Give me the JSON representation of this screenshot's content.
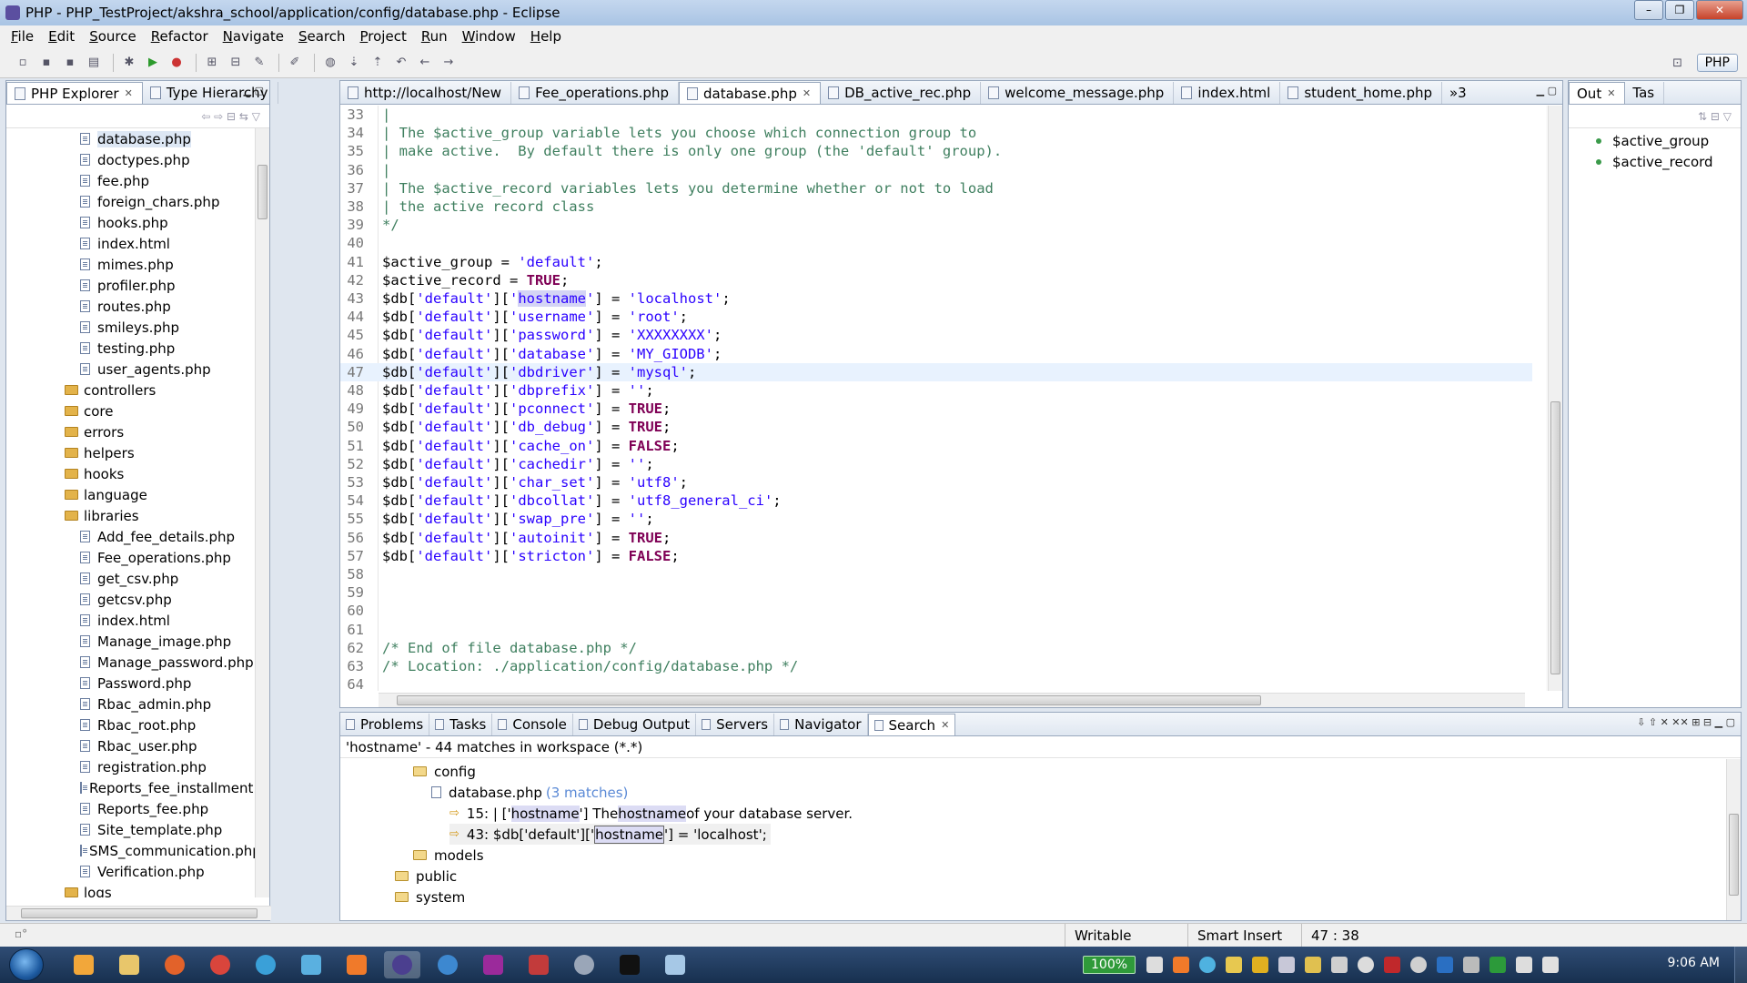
{
  "window": {
    "title": "PHP - PHP_TestProject/akshra_school/application/config/database.php - Eclipse",
    "min": "–",
    "max": "❐",
    "close": "✕"
  },
  "menu": [
    "File",
    "Edit",
    "Source",
    "Refactor",
    "Navigate",
    "Search",
    "Project",
    "Run",
    "Window",
    "Help"
  ],
  "perspective": {
    "label": "PHP"
  },
  "explorer": {
    "tabs": [
      {
        "label": "PHP Explorer",
        "close": "✕"
      },
      {
        "label": "Type Hierarchy"
      }
    ],
    "items": [
      {
        "label": "database.php",
        "kind": "file",
        "indent": 1,
        "selected": true
      },
      {
        "label": "doctypes.php",
        "kind": "file",
        "indent": 1
      },
      {
        "label": "fee.php",
        "kind": "file",
        "indent": 1
      },
      {
        "label": "foreign_chars.php",
        "kind": "file",
        "indent": 1
      },
      {
        "label": "hooks.php",
        "kind": "file",
        "indent": 1
      },
      {
        "label": "index.html",
        "kind": "file",
        "indent": 1
      },
      {
        "label": "mimes.php",
        "kind": "file",
        "indent": 1
      },
      {
        "label": "profiler.php",
        "kind": "file",
        "indent": 1
      },
      {
        "label": "routes.php",
        "kind": "file",
        "indent": 1
      },
      {
        "label": "smileys.php",
        "kind": "file",
        "indent": 1
      },
      {
        "label": "testing.php",
        "kind": "file",
        "indent": 1
      },
      {
        "label": "user_agents.php",
        "kind": "file",
        "indent": 1
      },
      {
        "label": "controllers",
        "kind": "folder",
        "indent": 0
      },
      {
        "label": "core",
        "kind": "folder",
        "indent": 0
      },
      {
        "label": "errors",
        "kind": "folder",
        "indent": 0
      },
      {
        "label": "helpers",
        "kind": "folder",
        "indent": 0
      },
      {
        "label": "hooks",
        "kind": "folder",
        "indent": 0
      },
      {
        "label": "language",
        "kind": "folder",
        "indent": 0
      },
      {
        "label": "libraries",
        "kind": "folder",
        "indent": 0
      },
      {
        "label": "Add_fee_details.php",
        "kind": "file",
        "indent": 1
      },
      {
        "label": "Fee_operations.php",
        "kind": "file",
        "indent": 1
      },
      {
        "label": "get_csv.php",
        "kind": "file",
        "indent": 1
      },
      {
        "label": "getcsv.php",
        "kind": "file",
        "indent": 1
      },
      {
        "label": "index.html",
        "kind": "file",
        "indent": 1
      },
      {
        "label": "Manage_image.php",
        "kind": "file",
        "indent": 1
      },
      {
        "label": "Manage_password.php",
        "kind": "file",
        "indent": 1
      },
      {
        "label": "Password.php",
        "kind": "file",
        "indent": 1
      },
      {
        "label": "Rbac_admin.php",
        "kind": "file",
        "indent": 1
      },
      {
        "label": "Rbac_root.php",
        "kind": "file",
        "indent": 1
      },
      {
        "label": "Rbac_user.php",
        "kind": "file",
        "indent": 1
      },
      {
        "label": "registration.php",
        "kind": "file",
        "indent": 1
      },
      {
        "label": "Reports_fee_installment.php",
        "kind": "file",
        "indent": 1
      },
      {
        "label": "Reports_fee.php",
        "kind": "file",
        "indent": 1
      },
      {
        "label": "Site_template.php",
        "kind": "file",
        "indent": 1
      },
      {
        "label": "SMS_communication.php",
        "kind": "file",
        "indent": 1
      },
      {
        "label": "Verification.php",
        "kind": "file",
        "indent": 1
      },
      {
        "label": "logs",
        "kind": "folder",
        "indent": 0
      }
    ]
  },
  "editor": {
    "tabs": [
      {
        "label": "http://localhost/New"
      },
      {
        "label": "Fee_operations.php"
      },
      {
        "label": "database.php",
        "active": true,
        "close": "✕"
      },
      {
        "label": "DB_active_rec.php"
      },
      {
        "label": "welcome_message.php"
      },
      {
        "label": "index.html"
      },
      {
        "label": "student_home.php"
      }
    ],
    "overflow": "»3",
    "current_line": 47,
    "lines": [
      {
        "n": "33",
        "parts": [
          {
            "t": "|",
            "c": "cm"
          }
        ]
      },
      {
        "n": "34",
        "parts": [
          {
            "t": "| The $active_group variable lets you choose which connection group to",
            "c": "cm"
          }
        ]
      },
      {
        "n": "35",
        "parts": [
          {
            "t": "| make active.  By default there is only one group (the 'default' group).",
            "c": "cm"
          }
        ]
      },
      {
        "n": "36",
        "parts": [
          {
            "t": "|",
            "c": "cm"
          }
        ]
      },
      {
        "n": "37",
        "parts": [
          {
            "t": "| The $active_record variables lets you determine whether or not to load",
            "c": "cm"
          }
        ]
      },
      {
        "n": "38",
        "parts": [
          {
            "t": "| the active record class",
            "c": "cm"
          }
        ]
      },
      {
        "n": "39",
        "parts": [
          {
            "t": "*/",
            "c": "cm"
          }
        ]
      },
      {
        "n": "40",
        "parts": []
      },
      {
        "n": "41",
        "parts": [
          {
            "t": "$active_group = "
          },
          {
            "t": "'default'",
            "c": "st"
          },
          {
            "t": ";"
          }
        ]
      },
      {
        "n": "42",
        "parts": [
          {
            "t": "$active_record = "
          },
          {
            "t": "TRUE",
            "c": "kw"
          },
          {
            "t": ";"
          }
        ]
      },
      {
        "n": "43",
        "parts": [
          {
            "t": "$db["
          },
          {
            "t": "'default'",
            "c": "st"
          },
          {
            "t": "]["
          },
          {
            "t": "'",
            "c": "st"
          },
          {
            "t": "hostname",
            "c": "st hl"
          },
          {
            "t": "'",
            "c": "st"
          },
          {
            "t": "] = "
          },
          {
            "t": "'localhost'",
            "c": "st"
          },
          {
            "t": ";"
          }
        ]
      },
      {
        "n": "44",
        "parts": [
          {
            "t": "$db["
          },
          {
            "t": "'default'",
            "c": "st"
          },
          {
            "t": "]["
          },
          {
            "t": "'username'",
            "c": "st"
          },
          {
            "t": "] = "
          },
          {
            "t": "'root'",
            "c": "st"
          },
          {
            "t": ";"
          }
        ]
      },
      {
        "n": "45",
        "parts": [
          {
            "t": "$db["
          },
          {
            "t": "'default'",
            "c": "st"
          },
          {
            "t": "]["
          },
          {
            "t": "'password'",
            "c": "st"
          },
          {
            "t": "] = "
          },
          {
            "t": "'XXXXXXXX'",
            "c": "st"
          },
          {
            "t": ";"
          }
        ]
      },
      {
        "n": "46",
        "parts": [
          {
            "t": "$db["
          },
          {
            "t": "'default'",
            "c": "st"
          },
          {
            "t": "]["
          },
          {
            "t": "'database'",
            "c": "st"
          },
          {
            "t": "] = "
          },
          {
            "t": "'MY_GIODB'",
            "c": "st"
          },
          {
            "t": ";"
          }
        ]
      },
      {
        "n": "47",
        "parts": [
          {
            "t": "$db["
          },
          {
            "t": "'default'",
            "c": "st"
          },
          {
            "t": "]["
          },
          {
            "t": "'dbdriver'",
            "c": "st"
          },
          {
            "t": "] = "
          },
          {
            "t": "'mysql'",
            "c": "st"
          },
          {
            "t": ";"
          }
        ]
      },
      {
        "n": "48",
        "parts": [
          {
            "t": "$db["
          },
          {
            "t": "'default'",
            "c": "st"
          },
          {
            "t": "]["
          },
          {
            "t": "'dbprefix'",
            "c": "st"
          },
          {
            "t": "] = "
          },
          {
            "t": "''",
            "c": "st"
          },
          {
            "t": ";"
          }
        ]
      },
      {
        "n": "49",
        "parts": [
          {
            "t": "$db["
          },
          {
            "t": "'default'",
            "c": "st"
          },
          {
            "t": "]["
          },
          {
            "t": "'pconnect'",
            "c": "st"
          },
          {
            "t": "] = "
          },
          {
            "t": "TRUE",
            "c": "kw"
          },
          {
            "t": ";"
          }
        ]
      },
      {
        "n": "50",
        "parts": [
          {
            "t": "$db["
          },
          {
            "t": "'default'",
            "c": "st"
          },
          {
            "t": "]["
          },
          {
            "t": "'db_debug'",
            "c": "st"
          },
          {
            "t": "] = "
          },
          {
            "t": "TRUE",
            "c": "kw"
          },
          {
            "t": ";"
          }
        ]
      },
      {
        "n": "51",
        "parts": [
          {
            "t": "$db["
          },
          {
            "t": "'default'",
            "c": "st"
          },
          {
            "t": "]["
          },
          {
            "t": "'cache_on'",
            "c": "st"
          },
          {
            "t": "] = "
          },
          {
            "t": "FALSE",
            "c": "kw"
          },
          {
            "t": ";"
          }
        ]
      },
      {
        "n": "52",
        "parts": [
          {
            "t": "$db["
          },
          {
            "t": "'default'",
            "c": "st"
          },
          {
            "t": "]["
          },
          {
            "t": "'cachedir'",
            "c": "st"
          },
          {
            "t": "] = "
          },
          {
            "t": "''",
            "c": "st"
          },
          {
            "t": ";"
          }
        ]
      },
      {
        "n": "53",
        "parts": [
          {
            "t": "$db["
          },
          {
            "t": "'default'",
            "c": "st"
          },
          {
            "t": "]["
          },
          {
            "t": "'char_set'",
            "c": "st"
          },
          {
            "t": "] = "
          },
          {
            "t": "'utf8'",
            "c": "st"
          },
          {
            "t": ";"
          }
        ]
      },
      {
        "n": "54",
        "parts": [
          {
            "t": "$db["
          },
          {
            "t": "'default'",
            "c": "st"
          },
          {
            "t": "]["
          },
          {
            "t": "'dbcollat'",
            "c": "st"
          },
          {
            "t": "] = "
          },
          {
            "t": "'utf8_general_ci'",
            "c": "st"
          },
          {
            "t": ";"
          }
        ]
      },
      {
        "n": "55",
        "parts": [
          {
            "t": "$db["
          },
          {
            "t": "'default'",
            "c": "st"
          },
          {
            "t": "]["
          },
          {
            "t": "'swap_pre'",
            "c": "st"
          },
          {
            "t": "] = "
          },
          {
            "t": "''",
            "c": "st"
          },
          {
            "t": ";"
          }
        ]
      },
      {
        "n": "56",
        "parts": [
          {
            "t": "$db["
          },
          {
            "t": "'default'",
            "c": "st"
          },
          {
            "t": "]["
          },
          {
            "t": "'autoinit'",
            "c": "st"
          },
          {
            "t": "] = "
          },
          {
            "t": "TRUE",
            "c": "kw"
          },
          {
            "t": ";"
          }
        ]
      },
      {
        "n": "57",
        "parts": [
          {
            "t": "$db["
          },
          {
            "t": "'default'",
            "c": "st"
          },
          {
            "t": "]["
          },
          {
            "t": "'stricton'",
            "c": "st"
          },
          {
            "t": "] = "
          },
          {
            "t": "FALSE",
            "c": "kw"
          },
          {
            "t": ";"
          }
        ]
      },
      {
        "n": "58",
        "parts": []
      },
      {
        "n": "59",
        "parts": []
      },
      {
        "n": "60",
        "parts": []
      },
      {
        "n": "61",
        "parts": []
      },
      {
        "n": "62",
        "parts": [
          {
            "t": "/* End of file database.php */",
            "c": "cm"
          }
        ]
      },
      {
        "n": "63",
        "parts": [
          {
            "t": "/* Location: ./application/config/database.php */",
            "c": "cm"
          }
        ]
      },
      {
        "n": "64",
        "parts": []
      }
    ]
  },
  "outline": {
    "tabs": [
      {
        "label": "Out",
        "close": "✕"
      },
      {
        "label": "Tas"
      }
    ],
    "items": [
      "$active_group",
      "$active_record"
    ]
  },
  "bottom": {
    "tabs": [
      {
        "label": "Problems"
      },
      {
        "label": "Tasks"
      },
      {
        "label": "Console"
      },
      {
        "label": "Debug Output"
      },
      {
        "label": "Servers"
      },
      {
        "label": "Navigator"
      },
      {
        "label": "Search",
        "active": true,
        "close": "✕"
      }
    ],
    "summary": "'hostname' - 44 matches in workspace (*.*)",
    "config_folder": "config",
    "file": {
      "label": "database.php",
      "count": "(3 matches)"
    },
    "match1": {
      "prefix": "15: | ['",
      "m1": "hostname",
      "mid": "'] The ",
      "m2": "hostname",
      "suffix": " of your database server."
    },
    "match2": {
      "prefix": "43: $db['default']['",
      "m1": "hostname",
      "suffix": "'] = 'localhost';"
    },
    "folders": [
      "models",
      "public",
      "system"
    ]
  },
  "status": {
    "mode": "Writable",
    "insert": "Smart Insert",
    "position": "47 : 38"
  },
  "taskbar": {
    "zoom": "100%",
    "clock": "9:06 AM"
  }
}
